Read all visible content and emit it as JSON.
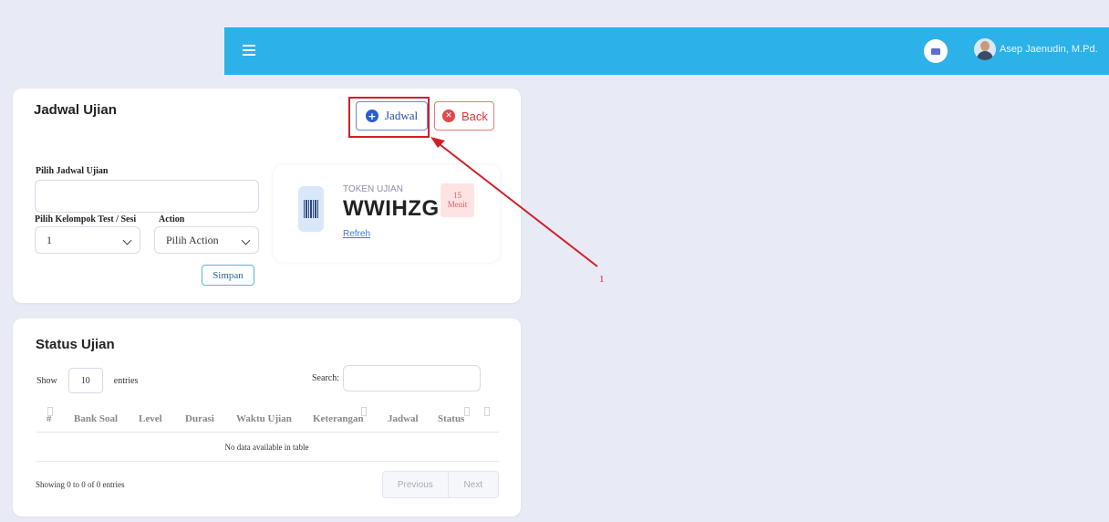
{
  "header": {
    "menu_icon": "hamburger-icon",
    "mail_icon": "envelope-icon",
    "user_name": "Asep Jaenudin, M.Pd.",
    "color": "#2cb1e8"
  },
  "jadwal_card": {
    "title": "Jadwal Ujian",
    "jadwal_button": "Jadwal",
    "back_button": "Back",
    "pilih_jadwal_label": "Pilih Jadwal Ujian",
    "pilih_jadwal_value": "",
    "kelompok_label": "Pilih Kelompok Test / Sesi",
    "kelompok_value": "1",
    "action_label": "Action",
    "action_value": "Pilih Action",
    "simpan_button": "Simpan",
    "token": {
      "label": "TOKEN UJIAN",
      "value": "WWIHZG",
      "refresh": "Refreh",
      "badge_number": "15",
      "badge_unit": "Menit"
    }
  },
  "status_card": {
    "title": "Status Ujian",
    "show_label": "Show",
    "entries_value": "10",
    "entries_label": "entries",
    "search_label": "Search:",
    "columns": [
      "#",
      "Bank Soal",
      "Level",
      "Durasi",
      "Waktu Ujian",
      "Keterangan",
      "Jadwal",
      "Status"
    ],
    "empty_message": "No data available in table",
    "info": "Showing 0 to 0 of 0 entries",
    "previous": "Previous",
    "next": "Next"
  },
  "annotation": {
    "number": "1",
    "color": "#d21f26"
  }
}
